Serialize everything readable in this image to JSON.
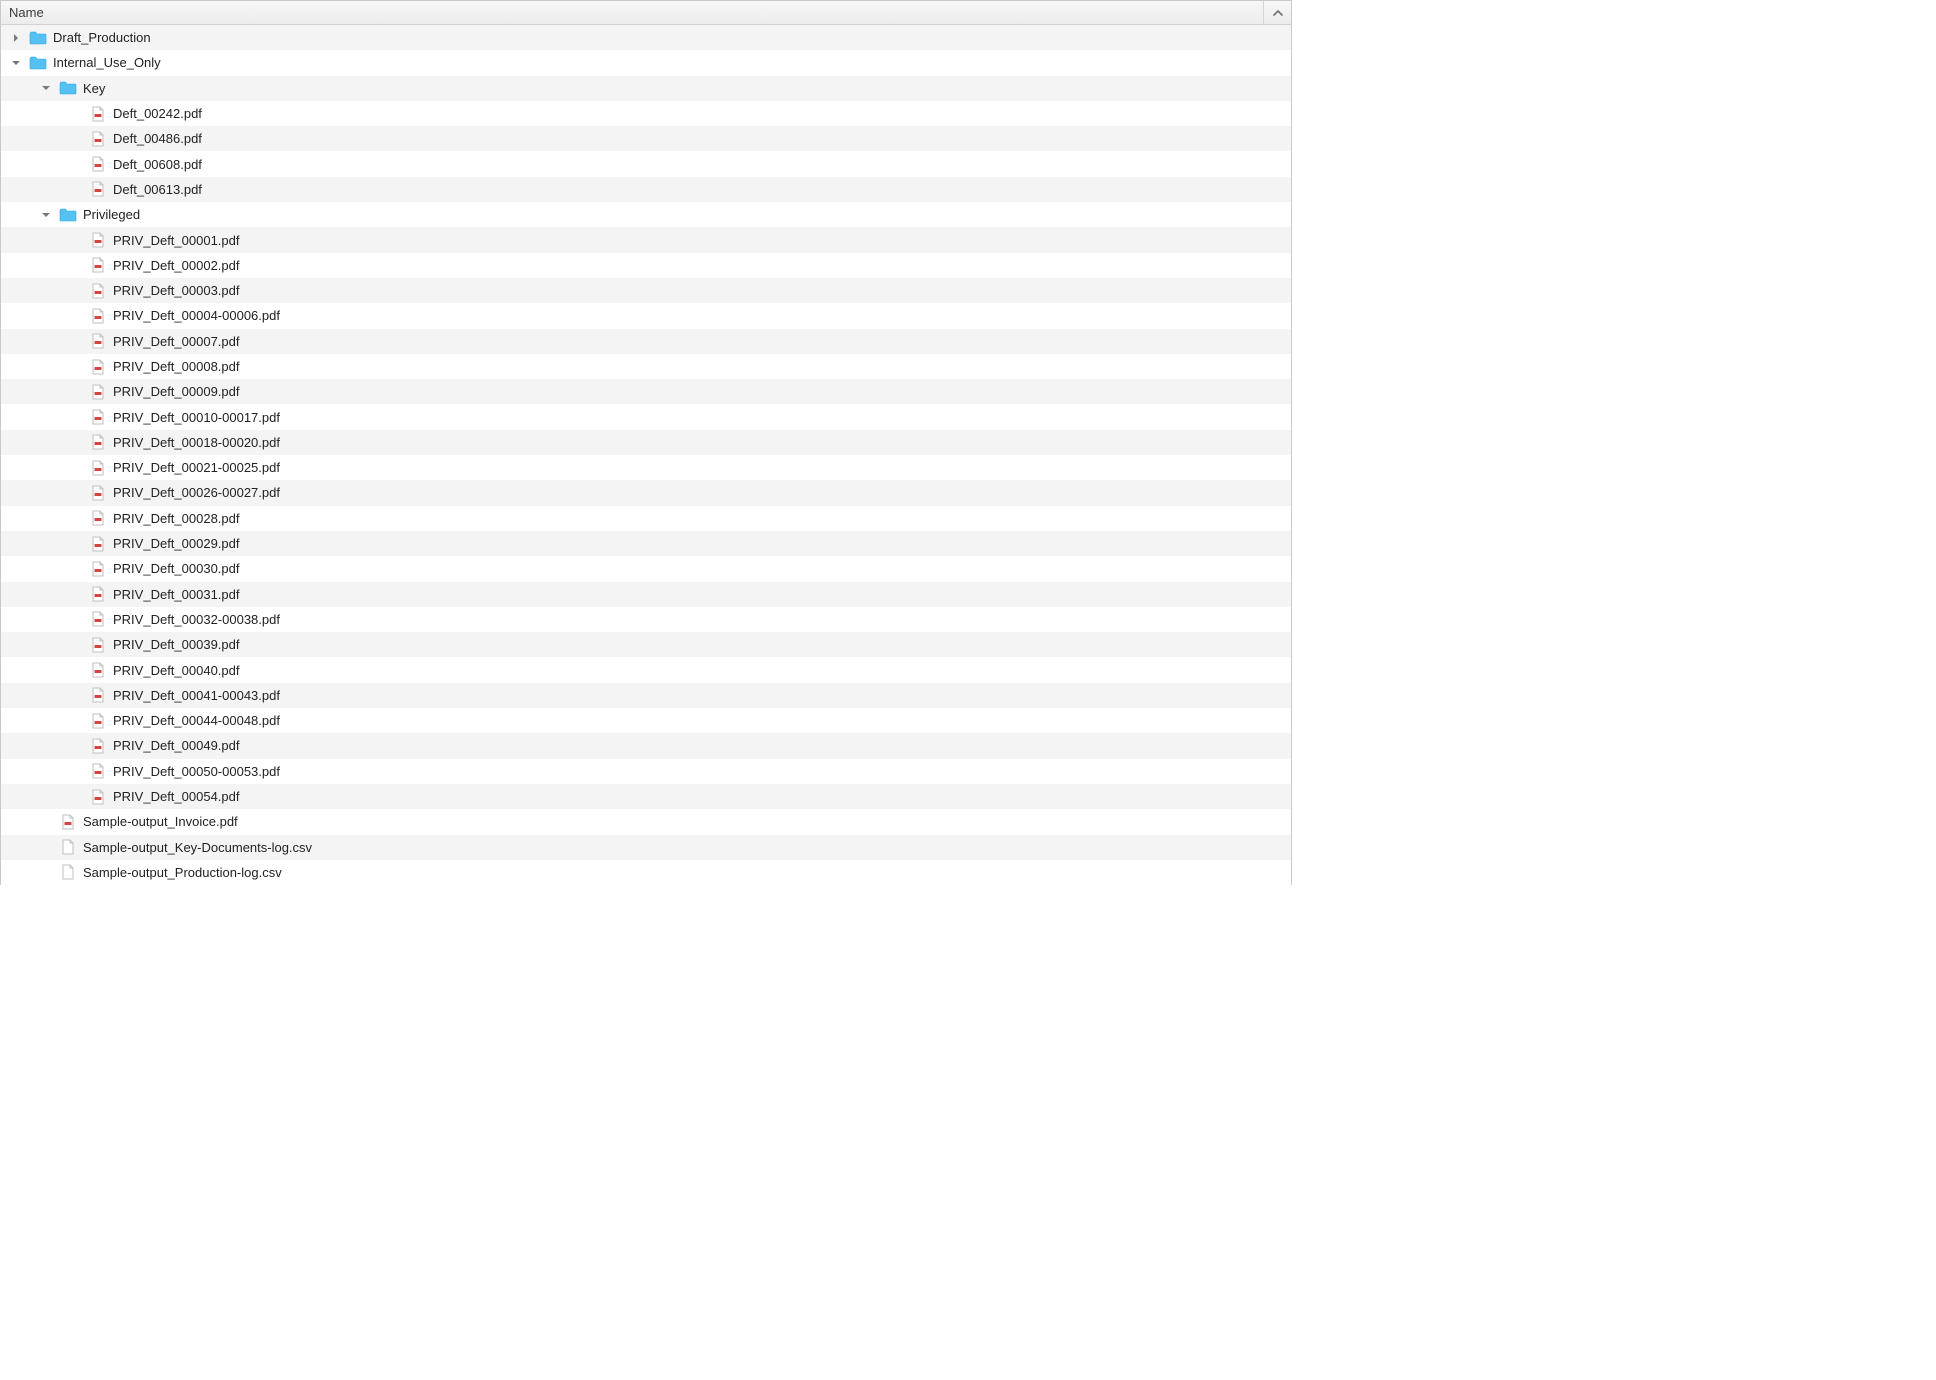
{
  "header": {
    "name_column": "Name",
    "sort_direction": "asc"
  },
  "colors": {
    "alt_row": "#f4f4f4",
    "folder": "#4ab7ee",
    "disclosure": "#7a7a7a"
  },
  "tree": [
    {
      "level": 0,
      "type": "folder",
      "expanded": false,
      "name": "Draft_Production"
    },
    {
      "level": 0,
      "type": "folder",
      "expanded": true,
      "name": "Internal_Use_Only"
    },
    {
      "level": 1,
      "type": "folder",
      "expanded": true,
      "name": "Key"
    },
    {
      "level": 2,
      "type": "file-pdf",
      "name": "Deft_00242.pdf"
    },
    {
      "level": 2,
      "type": "file-pdf",
      "name": "Deft_00486.pdf"
    },
    {
      "level": 2,
      "type": "file-pdf",
      "name": "Deft_00608.pdf"
    },
    {
      "level": 2,
      "type": "file-pdf",
      "name": "Deft_00613.pdf"
    },
    {
      "level": 1,
      "type": "folder",
      "expanded": true,
      "name": "Privileged"
    },
    {
      "level": 2,
      "type": "file-pdf",
      "name": "PRIV_Deft_00001.pdf"
    },
    {
      "level": 2,
      "type": "file-pdf",
      "name": "PRIV_Deft_00002.pdf"
    },
    {
      "level": 2,
      "type": "file-pdf",
      "name": "PRIV_Deft_00003.pdf"
    },
    {
      "level": 2,
      "type": "file-pdf",
      "name": "PRIV_Deft_00004-00006.pdf"
    },
    {
      "level": 2,
      "type": "file-pdf",
      "name": "PRIV_Deft_00007.pdf"
    },
    {
      "level": 2,
      "type": "file-pdf",
      "name": "PRIV_Deft_00008.pdf"
    },
    {
      "level": 2,
      "type": "file-pdf",
      "name": "PRIV_Deft_00009.pdf"
    },
    {
      "level": 2,
      "type": "file-pdf",
      "name": "PRIV_Deft_00010-00017.pdf"
    },
    {
      "level": 2,
      "type": "file-pdf",
      "name": "PRIV_Deft_00018-00020.pdf"
    },
    {
      "level": 2,
      "type": "file-pdf",
      "name": "PRIV_Deft_00021-00025.pdf"
    },
    {
      "level": 2,
      "type": "file-pdf",
      "name": "PRIV_Deft_00026-00027.pdf"
    },
    {
      "level": 2,
      "type": "file-pdf",
      "name": "PRIV_Deft_00028.pdf"
    },
    {
      "level": 2,
      "type": "file-pdf",
      "name": "PRIV_Deft_00029.pdf"
    },
    {
      "level": 2,
      "type": "file-pdf",
      "name": "PRIV_Deft_00030.pdf"
    },
    {
      "level": 2,
      "type": "file-pdf",
      "name": "PRIV_Deft_00031.pdf"
    },
    {
      "level": 2,
      "type": "file-pdf",
      "name": "PRIV_Deft_00032-00038.pdf"
    },
    {
      "level": 2,
      "type": "file-pdf",
      "name": "PRIV_Deft_00039.pdf"
    },
    {
      "level": 2,
      "type": "file-pdf",
      "name": "PRIV_Deft_00040.pdf"
    },
    {
      "level": 2,
      "type": "file-pdf",
      "name": "PRIV_Deft_00041-00043.pdf"
    },
    {
      "level": 2,
      "type": "file-pdf",
      "name": "PRIV_Deft_00044-00048.pdf"
    },
    {
      "level": 2,
      "type": "file-pdf",
      "name": "PRIV_Deft_00049.pdf"
    },
    {
      "level": 2,
      "type": "file-pdf",
      "name": "PRIV_Deft_00050-00053.pdf"
    },
    {
      "level": 2,
      "type": "file-pdf",
      "name": "PRIV_Deft_00054.pdf"
    },
    {
      "level": 1,
      "type": "file-pdf",
      "name": "Sample-output_Invoice.pdf"
    },
    {
      "level": 1,
      "type": "file-csv",
      "name": "Sample-output_Key-Documents-log.csv"
    },
    {
      "level": 1,
      "type": "file-csv",
      "name": "Sample-output_Production-log.csv"
    }
  ]
}
